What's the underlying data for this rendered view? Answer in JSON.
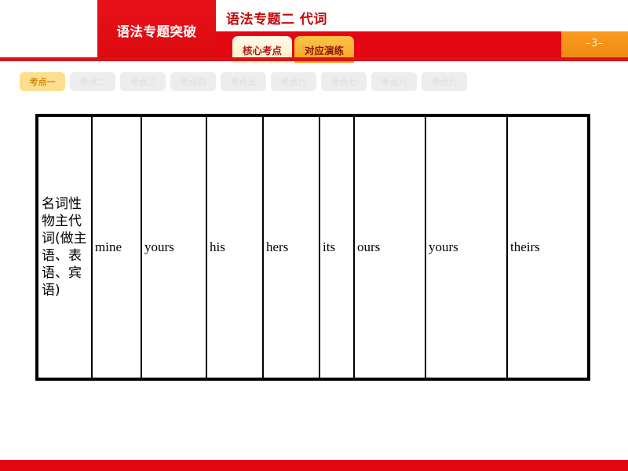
{
  "header": {
    "series_title": "语法专题突破",
    "page_title": "语法专题二  代词",
    "page_number": "–3–",
    "tabs": [
      {
        "label": "核心考点",
        "active": true
      },
      {
        "label": "对应演练",
        "active": false
      }
    ]
  },
  "pill_nav": {
    "items": [
      {
        "label": "考点一",
        "active": true
      },
      {
        "label": "考点二",
        "active": false
      },
      {
        "label": "考点三",
        "active": false
      },
      {
        "label": "考点四",
        "active": false
      },
      {
        "label": "考点五",
        "active": false
      },
      {
        "label": "考点六",
        "active": false
      },
      {
        "label": "考点七",
        "active": false
      },
      {
        "label": "考点八",
        "active": false
      },
      {
        "label": "考点九",
        "active": false
      }
    ]
  },
  "table": {
    "row_label": "名词性物主代词(做主语、表语、宾语)",
    "cells": [
      "mine",
      "yours",
      "his",
      "hers",
      "its",
      "ours",
      "yours",
      "theirs"
    ]
  },
  "colors": {
    "brand_red": "#e30613",
    "dark_red": "#c20a0a",
    "accent_orange": "#f7941e",
    "active_pill": "#fbdf8e",
    "inactive_pill": "#ededed"
  }
}
